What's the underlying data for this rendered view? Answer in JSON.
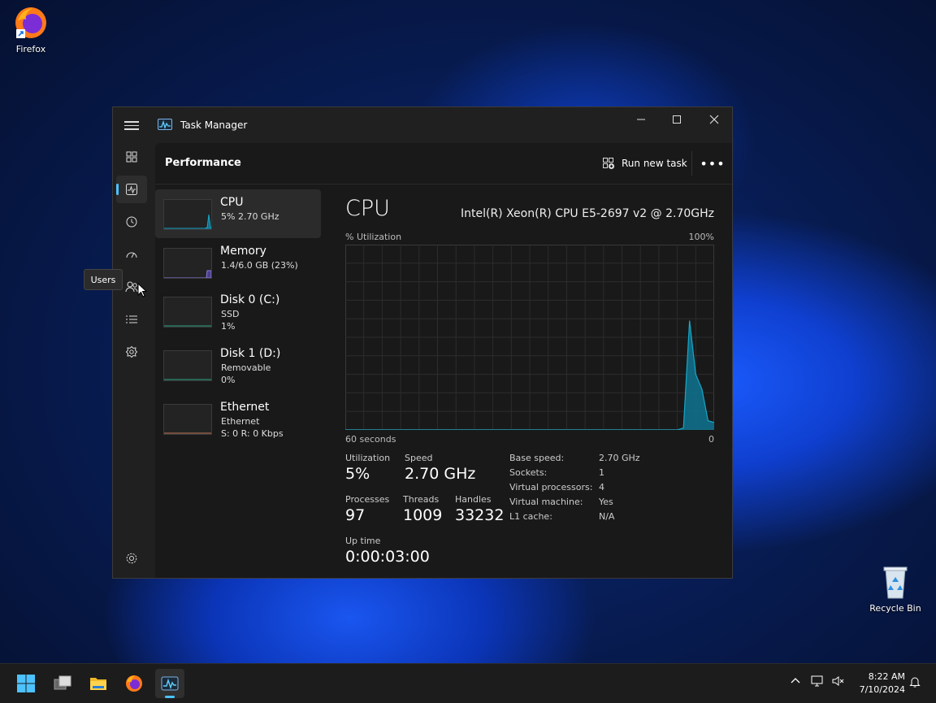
{
  "desktop": {
    "firefox_label": "Firefox",
    "recycle_label": "Recycle Bin"
  },
  "window": {
    "title": "Task Manager",
    "page_title": "Performance",
    "run_new_task": "Run new task",
    "tooltip": "Users"
  },
  "perf_list": [
    {
      "name": "CPU",
      "line2": "5%  2.70 GHz",
      "line3": ""
    },
    {
      "name": "Memory",
      "line2": "1.4/6.0 GB (23%)",
      "line3": ""
    },
    {
      "name": "Disk 0 (C:)",
      "line2": "SSD",
      "line3": "1%"
    },
    {
      "name": "Disk 1 (D:)",
      "line2": "Removable",
      "line3": "0%"
    },
    {
      "name": "Ethernet",
      "line2": "Ethernet",
      "line3": "S: 0  R: 0 Kbps"
    }
  ],
  "cpu": {
    "title": "CPU",
    "model": "Intel(R) Xeon(R) CPU E5-2697 v2 @ 2.70GHz",
    "util_label": "% Utilization",
    "max_label": "100%",
    "time_label": "60 seconds",
    "min_label": "0",
    "stats": {
      "utilization_label": "Utilization",
      "utilization": "5%",
      "speed_label": "Speed",
      "speed": "2.70 GHz",
      "processes_label": "Processes",
      "processes": "97",
      "threads_label": "Threads",
      "threads": "1009",
      "handles_label": "Handles",
      "handles": "33232",
      "uptime_label": "Up time",
      "uptime": "0:00:03:00"
    },
    "details": [
      {
        "k": "Base speed:",
        "v": "2.70 GHz"
      },
      {
        "k": "Sockets:",
        "v": "1"
      },
      {
        "k": "Virtual processors:",
        "v": "4"
      },
      {
        "k": "Virtual machine:",
        "v": "Yes"
      },
      {
        "k": "L1 cache:",
        "v": "N/A"
      }
    ]
  },
  "chart_data": {
    "type": "area",
    "ylim": [
      0,
      100
    ],
    "x": [
      0,
      1,
      2,
      3,
      4,
      5,
      6,
      7,
      8,
      9,
      10,
      11,
      12,
      13,
      14,
      15,
      16,
      17,
      18,
      19,
      20,
      21,
      22,
      23,
      24,
      25,
      26,
      27,
      28,
      29,
      30,
      31,
      32,
      33,
      34,
      35,
      36,
      37,
      38,
      39,
      40,
      41,
      42,
      43,
      44,
      45,
      46,
      47,
      48,
      49,
      50,
      51,
      52,
      53,
      54,
      55,
      56,
      57,
      58,
      59,
      60
    ],
    "values": [
      0,
      0,
      0,
      0,
      0,
      0,
      0,
      0,
      0,
      0,
      0,
      0,
      0,
      0,
      0,
      0,
      0,
      0,
      0,
      0,
      0,
      0,
      0,
      0,
      0,
      0,
      0,
      0,
      0,
      0,
      0,
      0,
      0,
      0,
      0,
      0,
      0,
      0,
      0,
      0,
      0,
      0,
      0,
      0,
      0,
      0,
      0,
      0,
      0,
      0,
      0,
      0,
      0,
      0,
      0,
      1,
      59,
      30,
      22,
      5,
      4
    ]
  },
  "colors": {
    "accent": "#4cc2ff",
    "cpu_line": "#17a7c9",
    "cpu_fill": "#0f6f89",
    "memory_line": "#8a7be0",
    "disk_line": "#2fa58a",
    "ethernet_line": "#c27a5a"
  },
  "taskbar": {
    "time": "8:22 AM",
    "date": "7/10/2024"
  }
}
